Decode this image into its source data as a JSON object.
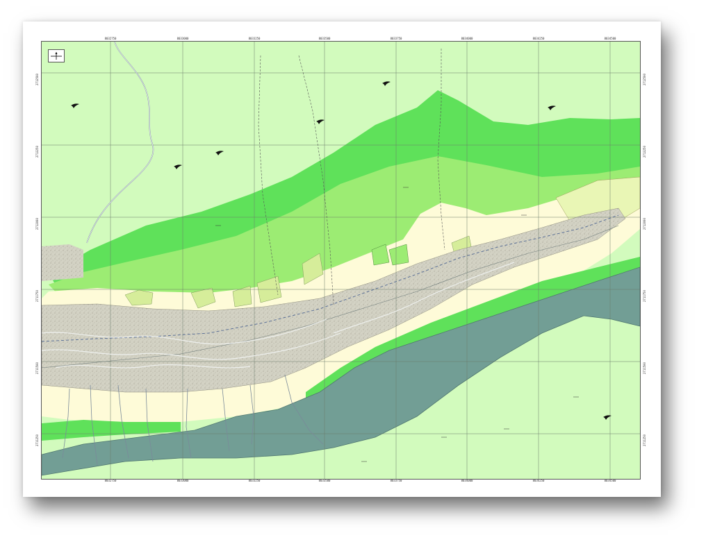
{
  "map": {
    "colors": {
      "background": "#d2fbbd",
      "upper_terrace": "#5fe15a",
      "mid_terrace": "#9cec73",
      "low_terrace": "#e9f6b5",
      "floodplain": "#fefbd8",
      "riverbed": "#d3d2c4",
      "water_body": "#729e95",
      "wetland": "#d6ed9a",
      "grid": "#6b7a6b",
      "river_line": "#5a6f96"
    },
    "icons": [
      "north-arrow-icon",
      "bird-symbol-icon"
    ],
    "ticks": {
      "top": [
        "8032750",
        "8033000",
        "8033250",
        "8033500",
        "8033750",
        "8034000",
        "8034250",
        "8034500"
      ],
      "bottom": [
        "8032750",
        "8033000",
        "8033250",
        "8033500",
        "8033750",
        "8034000",
        "8034250",
        "8034500"
      ],
      "left": [
        "2712500",
        "2712250",
        "2712000",
        "2711750",
        "2711500",
        "2711250"
      ],
      "right": [
        "2712500",
        "2712250",
        "2712000",
        "2711750",
        "2711500",
        "2711250"
      ]
    },
    "labels": [
      "d",
      "Qr",
      "Ka",
      "Ko",
      "Qa",
      "Qt",
      "Tg",
      "Kr",
      "Ms"
    ]
  }
}
